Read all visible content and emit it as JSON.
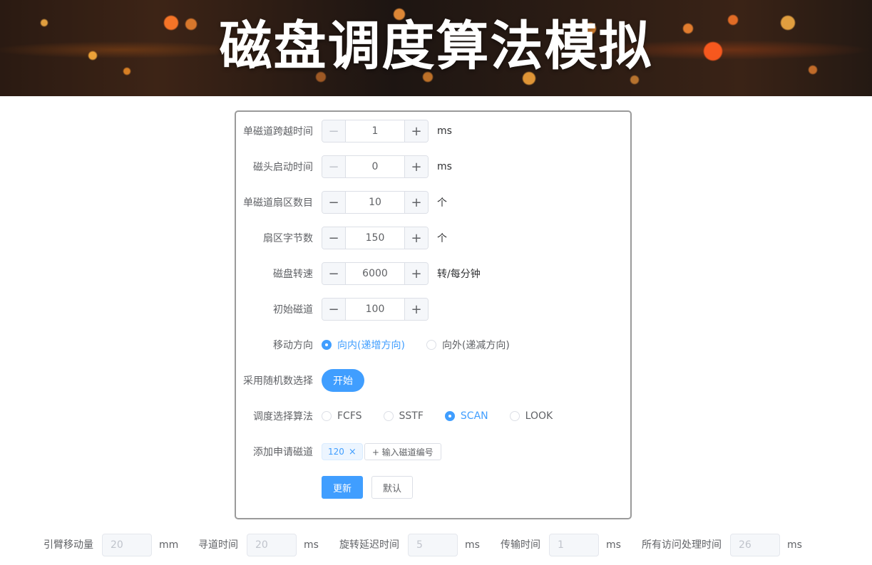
{
  "header": {
    "title": "磁盘调度算法模拟"
  },
  "form": {
    "track_time": {
      "label": "单磁道跨越时间",
      "value": "1",
      "unit": "ms"
    },
    "head_start": {
      "label": "磁头启动时间",
      "value": "0",
      "unit": "ms"
    },
    "sectors": {
      "label": "单磁道扇区数目",
      "value": "10",
      "unit": "个"
    },
    "sector_bytes": {
      "label": "扇区字节数",
      "value": "150",
      "unit": "个"
    },
    "rpm": {
      "label": "磁盘转速",
      "value": "6000",
      "unit": "转/每分钟"
    },
    "initial_track": {
      "label": "初始磁道",
      "value": "100"
    },
    "direction": {
      "label": "移动方向",
      "options": [
        "向内(递增方向)",
        "向外(递减方向)"
      ],
      "selected": "向内(递增方向)"
    },
    "random": {
      "label": "采用随机数选择",
      "button": "开始"
    },
    "algorithm": {
      "label": "调度选择算法",
      "options": [
        "FCFS",
        "SSTF",
        "SCAN",
        "LOOK"
      ],
      "selected": "SCAN"
    },
    "requests": {
      "label": "添加申请磁道",
      "tags": [
        "120"
      ],
      "add_button": "+ 输入磁道编号"
    },
    "update_button": "更新",
    "default_button": "默认"
  },
  "results": {
    "arm_movement": {
      "label": "引臂移动量",
      "value": "20",
      "unit": "mm"
    },
    "seek_time": {
      "label": "寻道时间",
      "value": "20",
      "unit": "ms"
    },
    "rotation_delay": {
      "label": "旋转延迟时间",
      "value": "5",
      "unit": "ms"
    },
    "transfer_time": {
      "label": "传输时间",
      "value": "1",
      "unit": "ms"
    },
    "total_time": {
      "label": "所有访问处理时间",
      "value": "26",
      "unit": "ms"
    }
  },
  "colors": {
    "primary": "#409eff",
    "panel_border": "#9a9a9a",
    "text": "#606266"
  }
}
